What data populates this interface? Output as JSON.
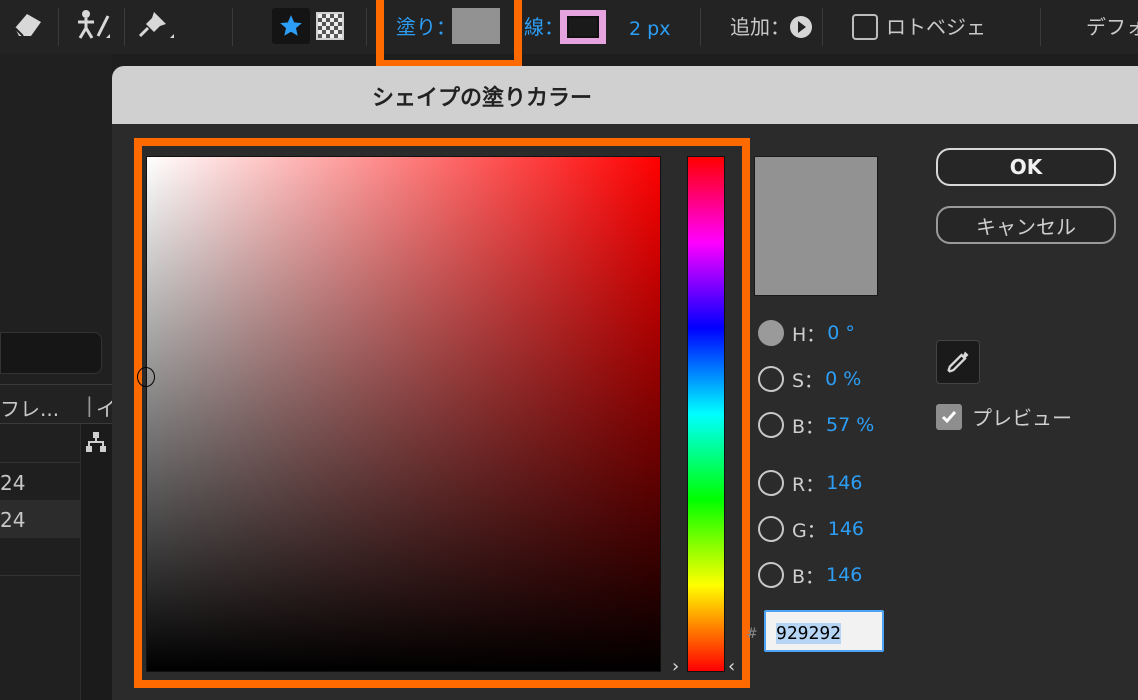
{
  "toolbar": {
    "fill_label": "塗り：",
    "stroke_label": "線：",
    "stroke_width": "2 px",
    "add_label": "追加：",
    "roto_bezier_label": "ロトベジェ",
    "default_label": "デフォ",
    "fill_color": "#929292",
    "stroke_color": "#e5a3e0",
    "highlight_color": "#ff6a00"
  },
  "background": {
    "column_header": "フレ...",
    "column_header_2": "イ",
    "row_1": "24",
    "row_2": "24"
  },
  "dialog": {
    "title": "シェイプの塗りカラー",
    "ok_label": "OK",
    "cancel_label": "キャンセル",
    "preview_label": "プレビュー",
    "hue_arrow_left": "›",
    "hue_arrow_right": "‹",
    "fields": {
      "h_label": "H：",
      "h_value": "0 °",
      "s_label": "S：",
      "s_value": "0 %",
      "b_label": "B：",
      "b_value": "57 %",
      "r_label": "R：",
      "r_value": "146",
      "g_label": "G：",
      "g_value": "146",
      "b2_label": "B：",
      "b2_value": "146"
    },
    "hash": "#",
    "hex_value": "929292",
    "current_color": "#929292",
    "preview_checked": true
  }
}
